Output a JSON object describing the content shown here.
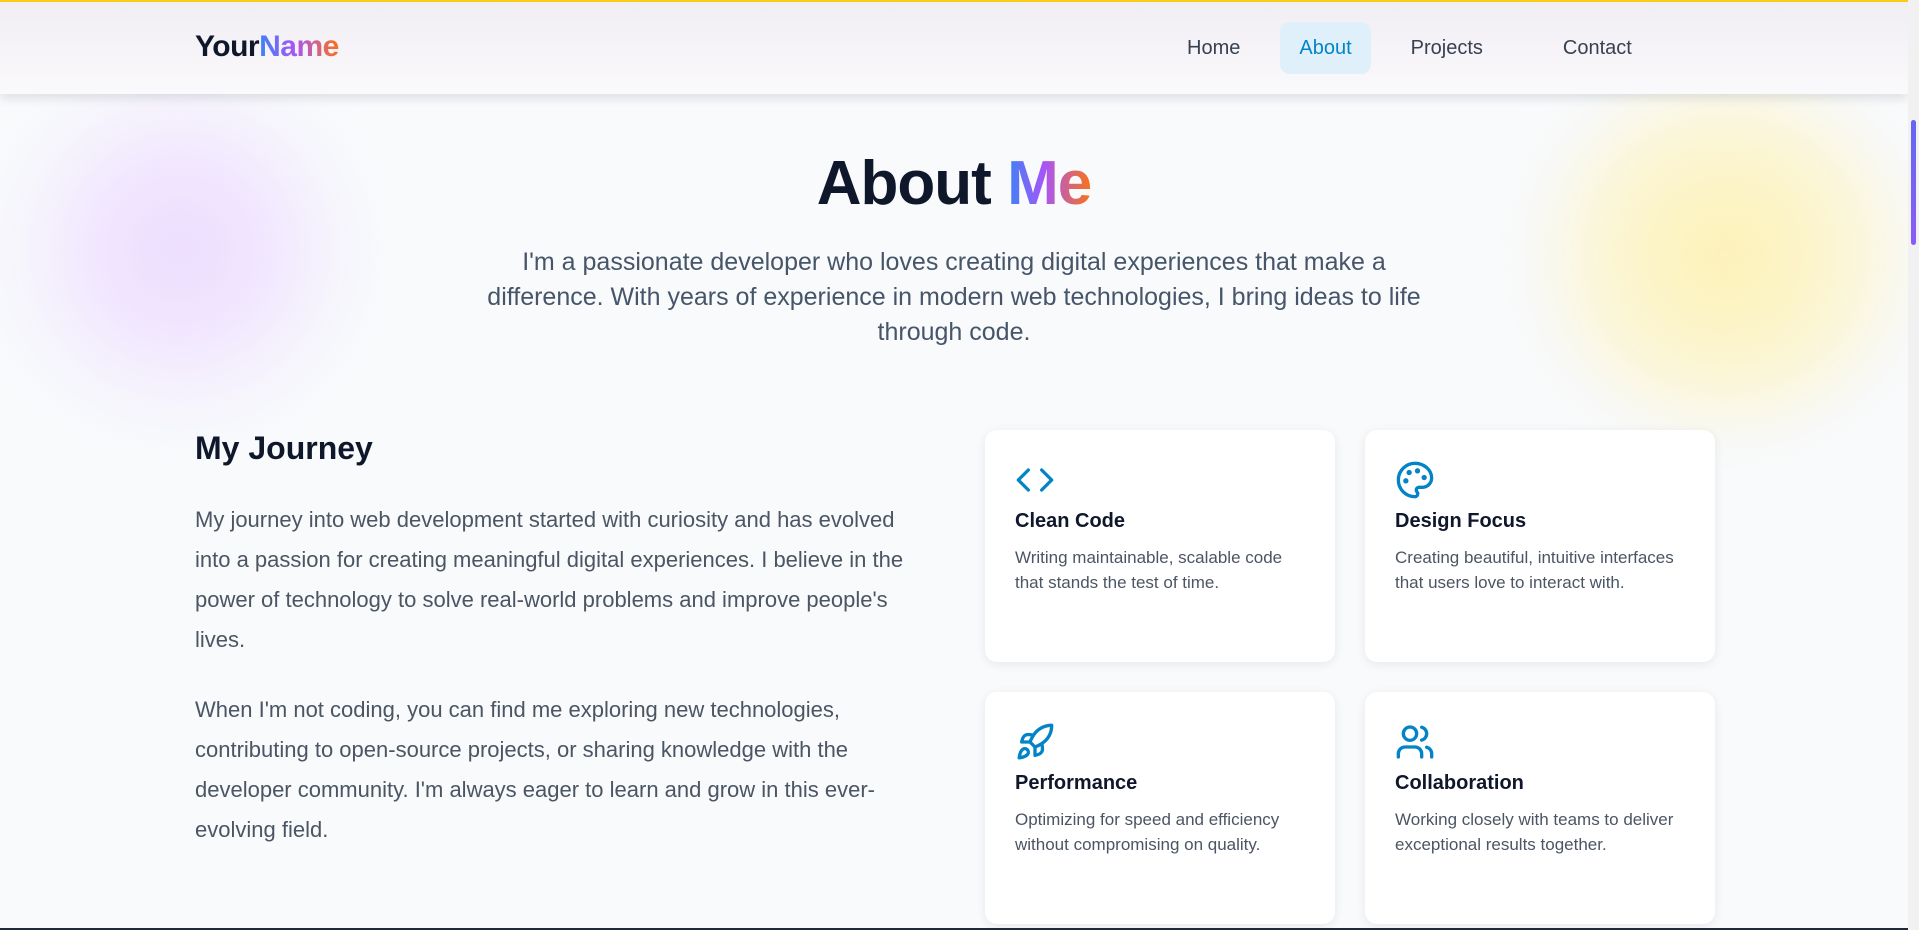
{
  "brand": {
    "part1": "Your",
    "part2": "Name"
  },
  "nav": {
    "items": [
      {
        "label": "Home"
      },
      {
        "label": "About",
        "active": true
      },
      {
        "label": "Projects"
      },
      {
        "label": "Contact"
      }
    ]
  },
  "hero": {
    "title_main": "About",
    "title_accent": "Me",
    "subtitle": "I'm a passionate developer who loves creating digital experiences that make a difference. With years of experience in modern web technologies, I bring ideas to life through code."
  },
  "journey": {
    "title": "My Journey",
    "paragraphs": [
      "My journey into web development started with curiosity and has evolved into a passion for creating meaningful digital experiences. I believe in the power of technology to solve real-world problems and improve people's lives.",
      "When I'm not coding, you can find me exploring new technologies, contributing to open-source projects, or sharing knowledge with the developer community. I'm always eager to learn and grow in this ever-evolving field."
    ]
  },
  "features": [
    {
      "icon": "code-icon",
      "title": "Clean Code",
      "desc": "Writing maintainable, scalable code that stands the test of time."
    },
    {
      "icon": "palette-icon",
      "title": "Design Focus",
      "desc": "Creating beautiful, intuitive interfaces that users love to interact with."
    },
    {
      "icon": "rocket-icon",
      "title": "Performance",
      "desc": "Optimizing for speed and efficiency without compromising on quality."
    },
    {
      "icon": "users-icon",
      "title": "Collaboration",
      "desc": "Working closely with teams to deliver exceptional results together."
    }
  ],
  "colors": {
    "accent": "#0284c7",
    "nav_active_bg": "#e0f0fb",
    "gradient_start": "#3b82f6",
    "gradient_mid": "#a855f7",
    "gradient_end": "#f97316",
    "top_line": "#facc15"
  }
}
